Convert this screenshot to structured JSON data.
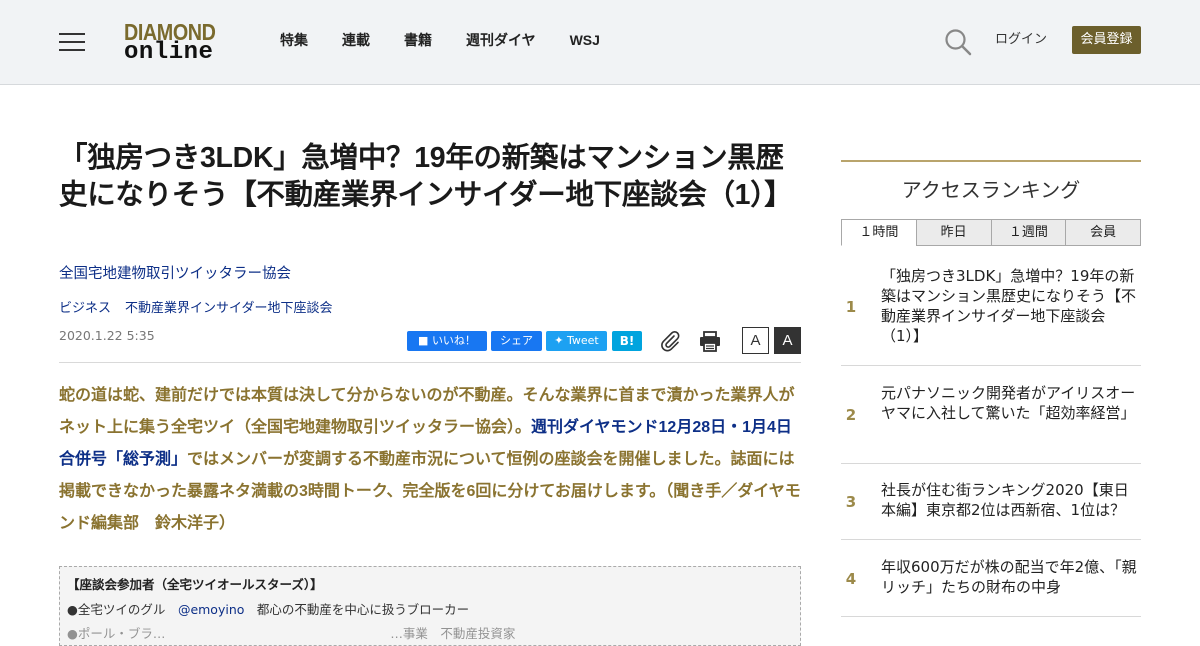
{
  "header": {
    "logo_line1": "DIAMOND",
    "logo_line2": "online",
    "nav": [
      "特集",
      "連載",
      "書籍",
      "週刊ダイヤ",
      "WSJ"
    ],
    "login": "ログイン",
    "register": "会員登録"
  },
  "article": {
    "title": "「独房つき3LDK」急増中？19年の新築はマンション黒歴史になりそう【不動産業界インサイダー地下座談会（1）】",
    "author": "全国宅地建物取引ツイッタラー協会",
    "tags": [
      "ビジネス",
      "不動産業界インサイダー地下座談会"
    ],
    "date": "2020.1.22 5:35",
    "share": {
      "facebook": "いいね！",
      "share": "シェア",
      "tweet": "Tweet",
      "hatena": "B!"
    },
    "font_small": "A",
    "font_large": "A",
    "lead_part1": "蛇の道は蛇、建前だけでは本質は決して分からないのが不動産。そんな業界に首まで漬かった業界人がネット上に集う全宅ツイ（全国宅地建物取引ツイッタラー協会）。",
    "lead_link": "週刊ダイヤモンド12月28日・1月4日合併号「総予測」",
    "lead_part2": "ではメンバーが変調する不動産市況について恒例の座談会を開催しました。誌面には掲載できなかった暴露ネタ満載の3時間トーク、完全版を6回に分けてお届けします。（聞き手／ダイヤモンド編集部　鈴木洋子）",
    "participants_heading": "【座談会参加者（全宅ツイオールスターズ）】",
    "participant1_name": "●全宅ツイのグル",
    "participant1_handle": "@emoyino",
    "participant1_desc": "都心の不動産を中心に扱うブローカー",
    "participant2_partial": "●ポール・ブラ…　　　　　　　　　　　　　　　　　　…事業　不動産投資家"
  },
  "sidebar": {
    "ranking_title": "アクセスランキング",
    "tabs": [
      "１時間",
      "昨日",
      "１週間",
      "会員"
    ],
    "active_tab": 0,
    "items": [
      {
        "rank": "1",
        "text": "「独房つき3LDK」急増中？19年の新築はマンション黒歴史になりそう【不動産業界インサイダー地下座談会（1）】"
      },
      {
        "rank": "2",
        "text": "元パナソニック開発者がアイリスオーヤマに入社して驚いた「超効率経営」"
      },
      {
        "rank": "3",
        "text": "社長が住む街ランキング2020【東日本編】東京都2位は西新宿、1位は？"
      },
      {
        "rank": "4",
        "text": "年収600万だが株の配当で年2億、「親リッチ」たちの財布の中身"
      }
    ]
  }
}
